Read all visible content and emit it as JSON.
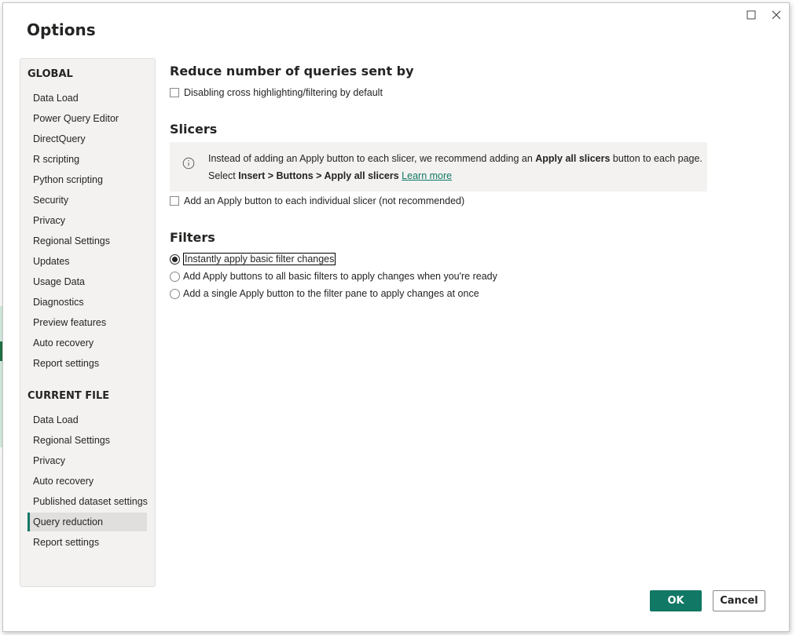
{
  "dialog": {
    "title": "Options"
  },
  "sidebar": {
    "global_header": "GLOBAL",
    "global_items": [
      {
        "label": "Data Load"
      },
      {
        "label": "Power Query Editor"
      },
      {
        "label": "DirectQuery"
      },
      {
        "label": "R scripting"
      },
      {
        "label": "Python scripting"
      },
      {
        "label": "Security"
      },
      {
        "label": "Privacy"
      },
      {
        "label": "Regional Settings"
      },
      {
        "label": "Updates"
      },
      {
        "label": "Usage Data"
      },
      {
        "label": "Diagnostics"
      },
      {
        "label": "Preview features"
      },
      {
        "label": "Auto recovery"
      },
      {
        "label": "Report settings"
      }
    ],
    "current_header": "CURRENT FILE",
    "current_items": [
      {
        "label": "Data Load"
      },
      {
        "label": "Regional Settings"
      },
      {
        "label": "Privacy"
      },
      {
        "label": "Auto recovery"
      },
      {
        "label": "Published dataset settings"
      },
      {
        "label": "Query reduction",
        "active": true
      },
      {
        "label": "Report settings"
      }
    ]
  },
  "main": {
    "reduce": {
      "title": "Reduce number of queries sent by",
      "checkbox_label": "Disabling cross highlighting/filtering by default",
      "checked": false
    },
    "slicers": {
      "title": "Slicers",
      "info_part1": "Instead of adding an Apply button to each slicer, we recommend adding an ",
      "info_bold1": "Apply all slicers",
      "info_part2": " button to each page.",
      "info_select": "Select ",
      "info_bold2": "Insert > Buttons > Apply all slicers",
      "learn_more": "Learn more",
      "checkbox_label": "Add an Apply button to each individual slicer (not recommended)",
      "checked": false
    },
    "filters": {
      "title": "Filters",
      "options": [
        {
          "label": "Instantly apply basic filter changes",
          "checked": true
        },
        {
          "label": "Add Apply buttons to all basic filters to apply changes when you're ready",
          "checked": false
        },
        {
          "label": "Add a single Apply button to the filter pane to apply changes at once",
          "checked": false
        }
      ]
    }
  },
  "footer": {
    "ok_label": "OK",
    "cancel_label": "Cancel"
  },
  "colors": {
    "accent": "#117865",
    "sidebar_bg": "#f3f2f1",
    "active_item_bg": "#e1dfdd"
  },
  "icons": [
    "maximize-icon",
    "close-icon",
    "info-icon"
  ]
}
